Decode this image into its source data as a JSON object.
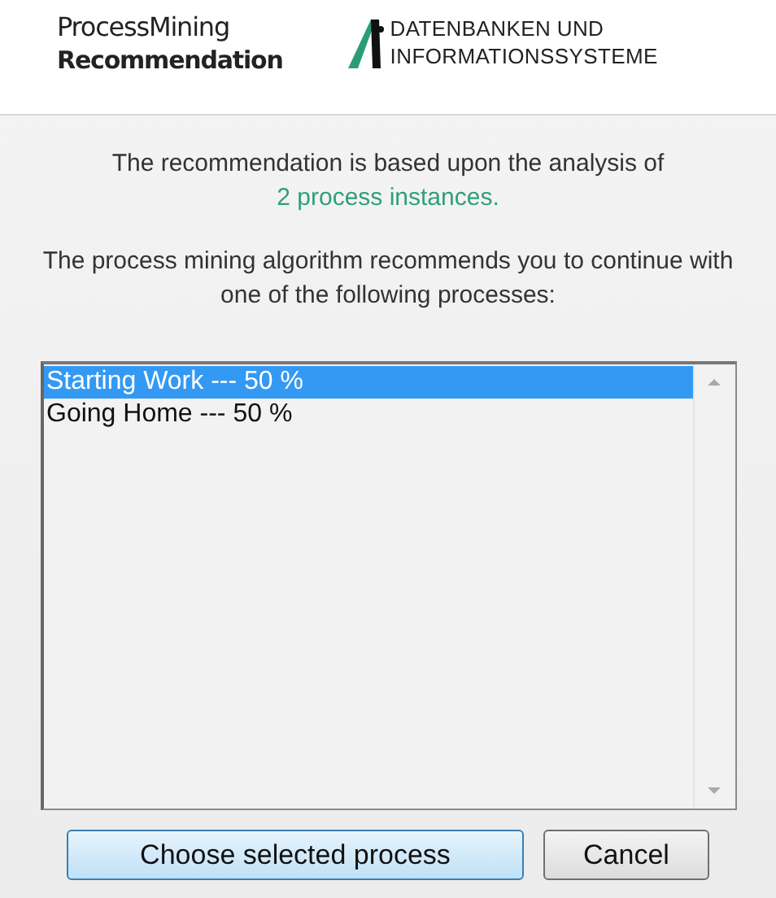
{
  "header": {
    "app_name": "ProcessMining",
    "app_subtitle": "Recommendation",
    "logo_line_1": "DATENBANKEN UND",
    "logo_line_2": "INFORMATIONSSYSTEME"
  },
  "analysis_text": "The recommendation is based upon the analysis of",
  "instances_text": "2 process instances.",
  "prompt_text": "The process mining algorithm recommends you to continue with one of the following processes:",
  "processes": [
    {
      "label": "Starting Work --- 50 %",
      "selected": true
    },
    {
      "label": "Going Home --- 50 %",
      "selected": false
    }
  ],
  "buttons": [
    {
      "label": "Choose selected process",
      "kind": "primary"
    },
    {
      "label": "Cancel",
      "kind": "normal"
    }
  ]
}
